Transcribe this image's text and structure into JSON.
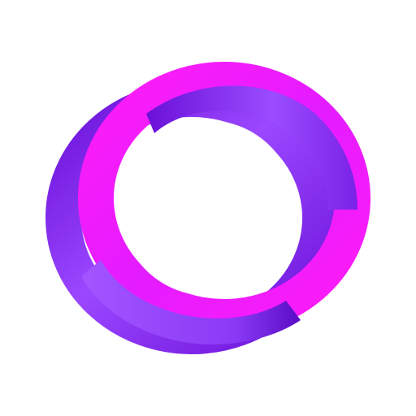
{
  "logo": {
    "icon": "interlocking-rings-logo-icon",
    "colors": {
      "background": "#ffffff",
      "magenta": "#ff1cf7",
      "purple_light": "#a04bff",
      "purple_dark": "#6a11d8"
    }
  }
}
